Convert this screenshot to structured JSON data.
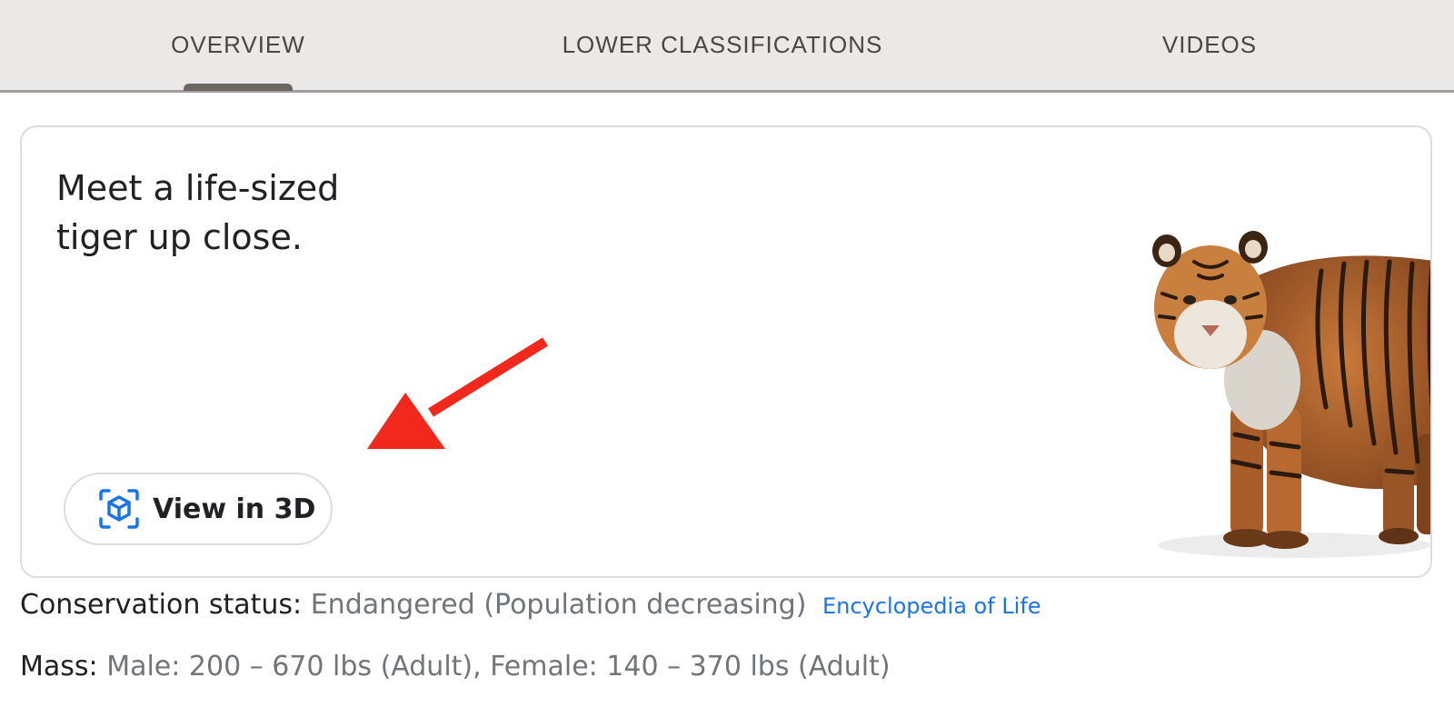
{
  "tabs": [
    {
      "label": "OVERVIEW",
      "active": true
    },
    {
      "label": "LOWER CLASSIFICATIONS",
      "active": false
    },
    {
      "label": "VIDEOS",
      "active": false
    }
  ],
  "card": {
    "title_line1": "Meet a life-sized",
    "title_line2": "tiger up close.",
    "button_label": "View in 3D",
    "button_icon": "ar-cube-icon",
    "accent_color": "#1a73e8",
    "annotation_color": "#f2281c"
  },
  "facts": {
    "conservation_label": "Conservation status:",
    "conservation_value": "Endangered (Population decreasing)",
    "conservation_source": "Encyclopedia of Life",
    "mass_label": "Mass:",
    "mass_value": "Male: 200 – 670 lbs (Adult), Female: 140 – 370 lbs (Adult)"
  }
}
